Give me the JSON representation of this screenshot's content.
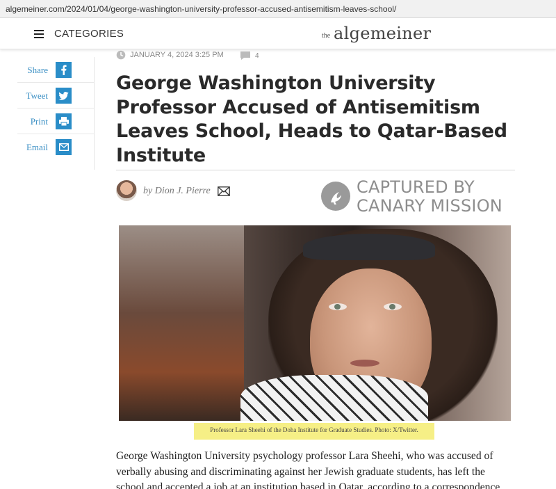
{
  "browser": {
    "url": "algemeiner.com/2024/01/04/george-washington-university-professor-accused-antisemitism-leaves-school/"
  },
  "nav": {
    "categories_label": "CATEGORIES",
    "logo_the": "the",
    "logo_name": "algemeiner"
  },
  "share": {
    "items": [
      {
        "label": "Share",
        "icon": "facebook-icon"
      },
      {
        "label": "Tweet",
        "icon": "twitter-icon"
      },
      {
        "label": "Print",
        "icon": "print-icon"
      },
      {
        "label": "Email",
        "icon": "email-icon"
      }
    ]
  },
  "article": {
    "date": "JANUARY 4, 2024 3:25 PM",
    "comment_count": "4",
    "headline_lines": [
      "George Washington University",
      "Professor Accused of Antisemitism",
      "Leaves School, Heads to Qatar-Based",
      "Institute"
    ],
    "byline": "by Dion J. Pierre",
    "watermark_lines": [
      "CAPTURED BY",
      "CANARY MISSION"
    ],
    "caption": "Professor Lara Sheehi of the Doha Institute for Graduate Studies. Photo: X/Twitter.",
    "body_lines": [
      "George Washington University psychology professor Lara Sheehi, who was accused of",
      "verbally abusing and discriminating against her Jewish graduate students, has left the",
      "school and accepted a job at an institution based in Qatar, according to a correspondence"
    ]
  },
  "colors": {
    "accent": "#2a8dc8",
    "caption_highlight": "#f6ef86"
  }
}
